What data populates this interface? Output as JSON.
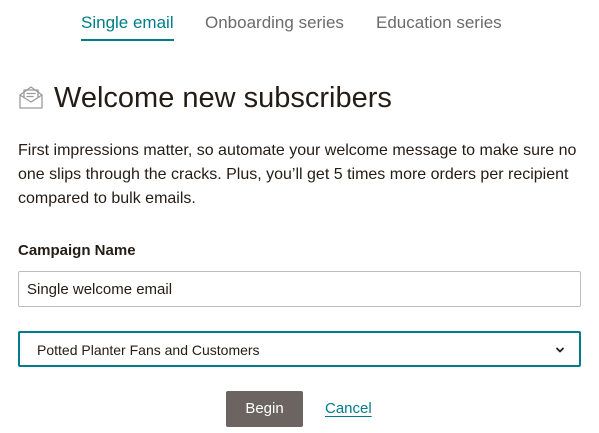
{
  "tabs": [
    {
      "label": "Single email",
      "active": true
    },
    {
      "label": "Onboarding series",
      "active": false
    },
    {
      "label": "Education series",
      "active": false
    }
  ],
  "heading": {
    "icon": "envelope-open-icon",
    "title": "Welcome new subscribers"
  },
  "description": "First impressions matter, so automate your welcome message to make sure no one slips through the cracks. Plus, you’ll get 5 times more orders per recipient compared to bulk emails.",
  "campaign_name": {
    "label": "Campaign Name",
    "value": "Single welcome email"
  },
  "audience_select": {
    "selected": "Potted Planter Fans and Customers",
    "icon": "chevron-down-icon"
  },
  "actions": {
    "begin_label": "Begin",
    "cancel_label": "Cancel"
  },
  "colors": {
    "accent": "#007c89",
    "text": "#241c15",
    "inactive_tab": "#6b6b6b",
    "button_bg": "#6b6461"
  }
}
